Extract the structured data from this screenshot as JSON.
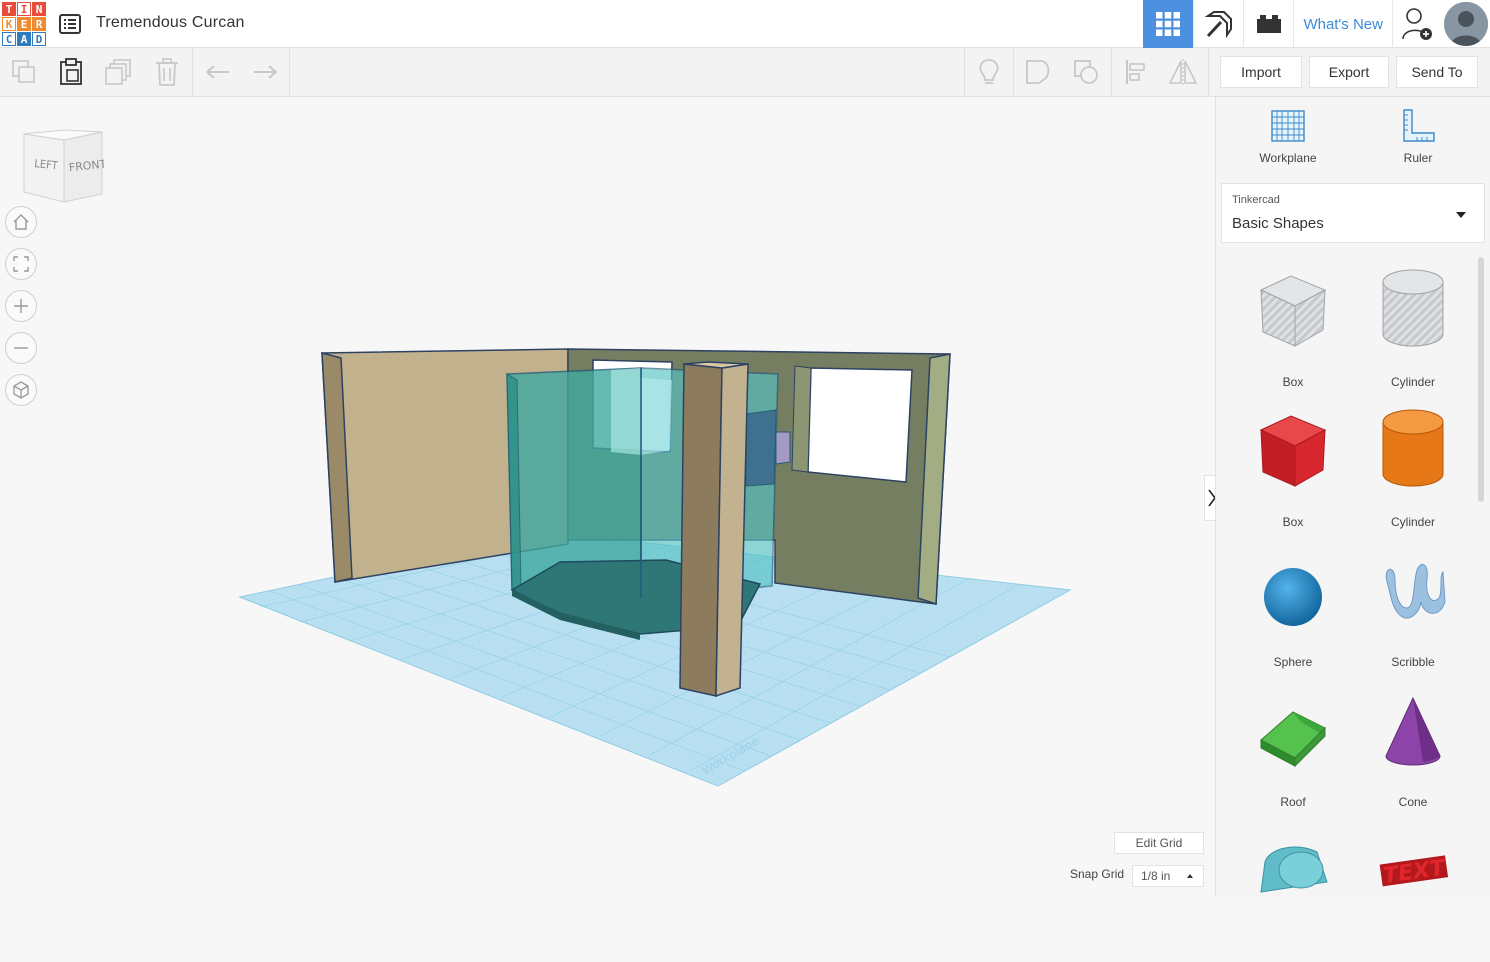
{
  "app": {
    "logo_letters": [
      "T",
      "I",
      "N",
      "K",
      "E",
      "R",
      "C",
      "A",
      "D"
    ],
    "logo_colors": [
      "#e84c3d",
      "#e84c3d",
      "#e84c3d",
      "#f28b30",
      "#f28b30",
      "#f28b30",
      "#2f7bbf",
      "#2f7bbf",
      "#2f7bbf"
    ],
    "design_title": "Tremendous Curcan"
  },
  "topbar": {
    "whats_new": "What's New",
    "buttons": [
      "grid-view-icon",
      "pickaxe-icon",
      "bricks-icon"
    ],
    "accent": "#4c8fde"
  },
  "toolbar": {
    "import_label": "Import",
    "export_label": "Export",
    "send_to_label": "Send To"
  },
  "viewcube": {
    "left_label": "LEFT",
    "front_label": "FRONT"
  },
  "panel": {
    "workplane_label": "Workplane",
    "ruler_label": "Ruler",
    "library_category": "Tinkercad",
    "library_name": "Basic Shapes",
    "shapes": [
      {
        "label": "Box",
        "color": "#c7cacf"
      },
      {
        "label": "Cylinder",
        "color": "#c7cacf"
      },
      {
        "label": "Box",
        "color": "#d8262e"
      },
      {
        "label": "Cylinder",
        "color": "#e67817"
      },
      {
        "label": "Sphere",
        "color": "#1f8dd0"
      },
      {
        "label": "Scribble",
        "color": "#9cc1e0"
      },
      {
        "label": "Roof",
        "color": "#3ca83a"
      },
      {
        "label": "Cone",
        "color": "#8d44a8"
      }
    ]
  },
  "grid": {
    "edit_grid_label": "Edit Grid",
    "snap_grid_label": "Snap Grid",
    "snap_value": "1/8 in",
    "workplane_watermark": "Workplane"
  }
}
